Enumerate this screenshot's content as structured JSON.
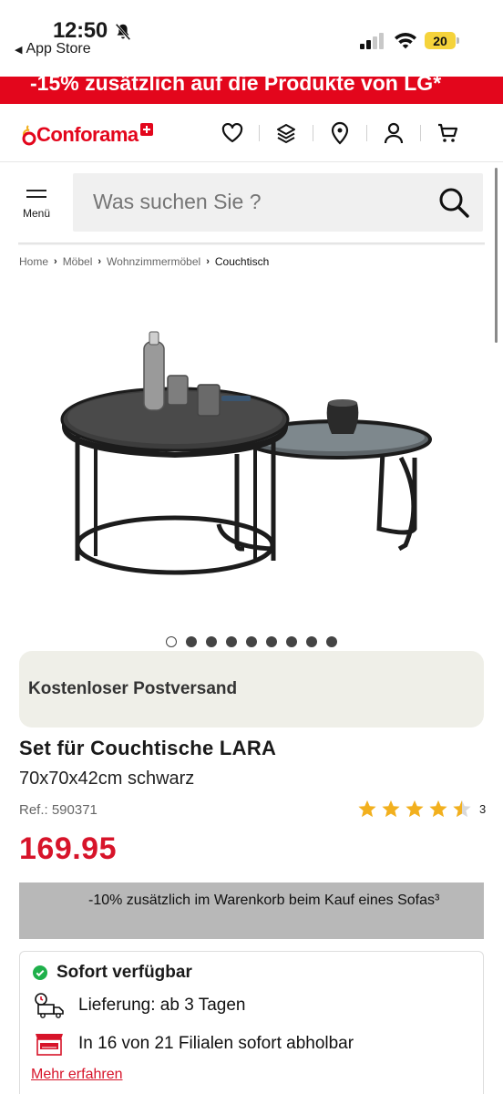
{
  "status_bar": {
    "time": "12:50",
    "back_app": "App Store",
    "battery": "20"
  },
  "promo": {
    "text": "-15% zusätzlich auf die Produkte von LG*"
  },
  "header": {
    "logo": "Conforama",
    "icons": [
      "heart-icon",
      "layers-icon",
      "location-pin-icon",
      "user-icon",
      "cart-icon"
    ]
  },
  "search": {
    "menu_label": "Menü",
    "placeholder": "Was suchen Sie ?"
  },
  "breadcrumb": {
    "items": [
      "Home",
      "Möbel",
      "Wohnzimmermöbel",
      "Couchtisch"
    ]
  },
  "carousel": {
    "count": 9,
    "active_index": 0
  },
  "shipping": {
    "text": "Kostenloser Postversand"
  },
  "product": {
    "title": "Set für Couchtische LARA",
    "subtitle": "70x70x42cm schwarz",
    "ref": "Ref.: 590371",
    "rating": 4.5,
    "rating_count": "3",
    "price": "169.95"
  },
  "discount": {
    "text": "-10% zusätzlich im Warenkorb beim Kauf eines Sofas³"
  },
  "availability": {
    "title": "Sofort verfügbar",
    "delivery": "Lieferung: ab 3 Tagen",
    "pickup": "In 16 von 21 Filialen sofort abholbar",
    "more_link": "Mehr erfahren"
  },
  "colors": {
    "brand_red": "#e3061c",
    "price_red": "#d7142a",
    "available_green": "#1fb04b",
    "star": "#f2b01e"
  }
}
